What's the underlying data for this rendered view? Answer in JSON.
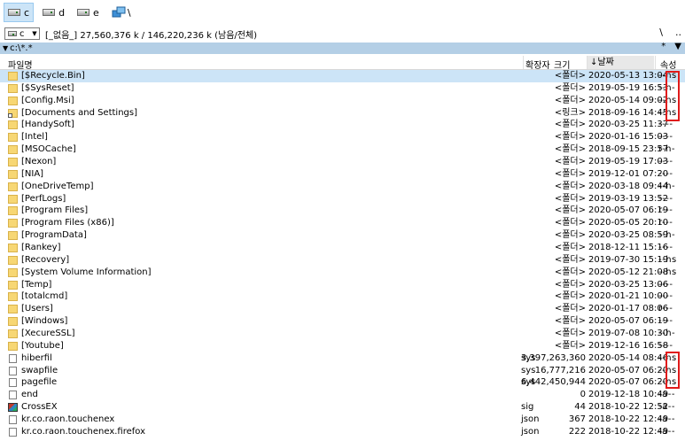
{
  "drives": [
    {
      "letter": "c",
      "active": true
    },
    {
      "letter": "d",
      "active": false
    },
    {
      "letter": "e",
      "active": false
    }
  ],
  "network_sep": "\\",
  "drive_select": "c",
  "drive_info": "[_없음_]  27,560,376 k / 146,220,236 k (남음/전체)",
  "root_btn": "\\",
  "parent_btn": "..",
  "path": "c:\\*.*",
  "filter_star": "*",
  "filter_arrow": "▼",
  "columns": {
    "name": "파일명",
    "ext": "확장자",
    "size": "크기",
    "date": "↓날짜",
    "attr": "속성"
  },
  "files": [
    {
      "name": "[$Recycle.Bin]",
      "ext": "",
      "size": "<폴더>",
      "date": "2020-05-13 13:04",
      "attr": "--hs",
      "icon": "folder-icon",
      "selected": true
    },
    {
      "name": "[$SysReset]",
      "ext": "",
      "size": "<폴더>",
      "date": "2019-05-19 16:53",
      "attr": "--h-",
      "icon": "folder-icon"
    },
    {
      "name": "[Config.Msi]",
      "ext": "",
      "size": "<폴더>",
      "date": "2020-05-14 09:02",
      "attr": "--hs",
      "icon": "folder-icon"
    },
    {
      "name": "[Documents and Settings]",
      "ext": "",
      "size": "<링크>",
      "date": "2018-09-16 14:45",
      "attr": "--hs",
      "icon": "link-icon"
    },
    {
      "name": "[HandySoft]",
      "ext": "",
      "size": "<폴더>",
      "date": "2020-03-25 11:37",
      "attr": "----",
      "icon": "folder-icon"
    },
    {
      "name": "[Intel]",
      "ext": "",
      "size": "<폴더>",
      "date": "2020-01-16 15:03",
      "attr": "----",
      "icon": "folder-icon"
    },
    {
      "name": "[MSOCache]",
      "ext": "",
      "size": "<폴더>",
      "date": "2018-09-15 23:57",
      "attr": "r-h-",
      "icon": "folder-icon"
    },
    {
      "name": "[Nexon]",
      "ext": "",
      "size": "<폴더>",
      "date": "2019-05-19 17:03",
      "attr": "----",
      "icon": "folder-icon"
    },
    {
      "name": "[NIA]",
      "ext": "",
      "size": "<폴더>",
      "date": "2019-12-01 07:20",
      "attr": "----",
      "icon": "folder-icon"
    },
    {
      "name": "[OneDriveTemp]",
      "ext": "",
      "size": "<폴더>",
      "date": "2020-03-18 09:44",
      "attr": "--h-",
      "icon": "folder-icon"
    },
    {
      "name": "[PerfLogs]",
      "ext": "",
      "size": "<폴더>",
      "date": "2019-03-19 13:52",
      "attr": "----",
      "icon": "folder-icon"
    },
    {
      "name": "[Program Files]",
      "ext": "",
      "size": "<폴더>",
      "date": "2020-05-07 06:19",
      "attr": "r---",
      "icon": "folder-icon"
    },
    {
      "name": "[Program Files (x86)]",
      "ext": "",
      "size": "<폴더>",
      "date": "2020-05-05 20:10",
      "attr": "r---",
      "icon": "folder-icon"
    },
    {
      "name": "[ProgramData]",
      "ext": "",
      "size": "<폴더>",
      "date": "2020-03-25 08:59",
      "attr": "--h-",
      "icon": "folder-icon"
    },
    {
      "name": "[Rankey]",
      "ext": "",
      "size": "<폴더>",
      "date": "2018-12-11 15:16",
      "attr": "----",
      "icon": "folder-icon"
    },
    {
      "name": "[Recovery]",
      "ext": "",
      "size": "<폴더>",
      "date": "2019-07-30 15:19",
      "attr": "--hs",
      "icon": "folder-icon"
    },
    {
      "name": "[System Volume Information]",
      "ext": "",
      "size": "<폴더>",
      "date": "2020-05-12 21:08",
      "attr": "--hs",
      "icon": "folder-icon"
    },
    {
      "name": "[Temp]",
      "ext": "",
      "size": "<폴더>",
      "date": "2020-03-25 13:06",
      "attr": "----",
      "icon": "folder-icon"
    },
    {
      "name": "[totalcmd]",
      "ext": "",
      "size": "<폴더>",
      "date": "2020-01-21 10:00",
      "attr": "----",
      "icon": "folder-icon"
    },
    {
      "name": "[Users]",
      "ext": "",
      "size": "<폴더>",
      "date": "2020-01-17 08:06",
      "attr": "r---",
      "icon": "folder-icon"
    },
    {
      "name": "[Windows]",
      "ext": "",
      "size": "<폴더>",
      "date": "2020-05-07 06:19",
      "attr": "----",
      "icon": "folder-icon"
    },
    {
      "name": "[XecureSSL]",
      "ext": "",
      "size": "<폴더>",
      "date": "2019-07-08 10:30",
      "attr": "--h-",
      "icon": "folder-icon"
    },
    {
      "name": "[Youtube]",
      "ext": "",
      "size": "<폴더>",
      "date": "2019-12-16 16:58",
      "attr": "----",
      "icon": "folder-icon"
    },
    {
      "name": "hiberfil",
      "ext": "sys",
      "size": "3,397,263,360",
      "date": "2020-05-14 08:46",
      "attr": "--hs",
      "icon": "file-icon"
    },
    {
      "name": "swapfile",
      "ext": "sys",
      "size": "16,777,216",
      "date": "2020-05-07 06:20",
      "attr": "--hs",
      "icon": "file-icon"
    },
    {
      "name": "pagefile",
      "ext": "sys",
      "size": "6,442,450,944",
      "date": "2020-05-07 06:20",
      "attr": "--hs",
      "icon": "file-icon"
    },
    {
      "name": "end",
      "ext": "",
      "size": "0",
      "date": "2019-12-18 10:49",
      "attr": "-a--",
      "icon": "file-icon"
    },
    {
      "name": "CrossEX",
      "ext": "sig",
      "size": "44",
      "date": "2018-10-22 12:52",
      "attr": "-a--",
      "icon": "app-icon"
    },
    {
      "name": "kr.co.raon.touchenex",
      "ext": "json",
      "size": "367",
      "date": "2018-10-22 12:49",
      "attr": "-a--",
      "icon": "file-icon"
    },
    {
      "name": "kr.co.raon.touchenex.firefox",
      "ext": "json",
      "size": "222",
      "date": "2018-10-22 12:49",
      "attr": "-a--",
      "icon": "file-icon"
    }
  ]
}
